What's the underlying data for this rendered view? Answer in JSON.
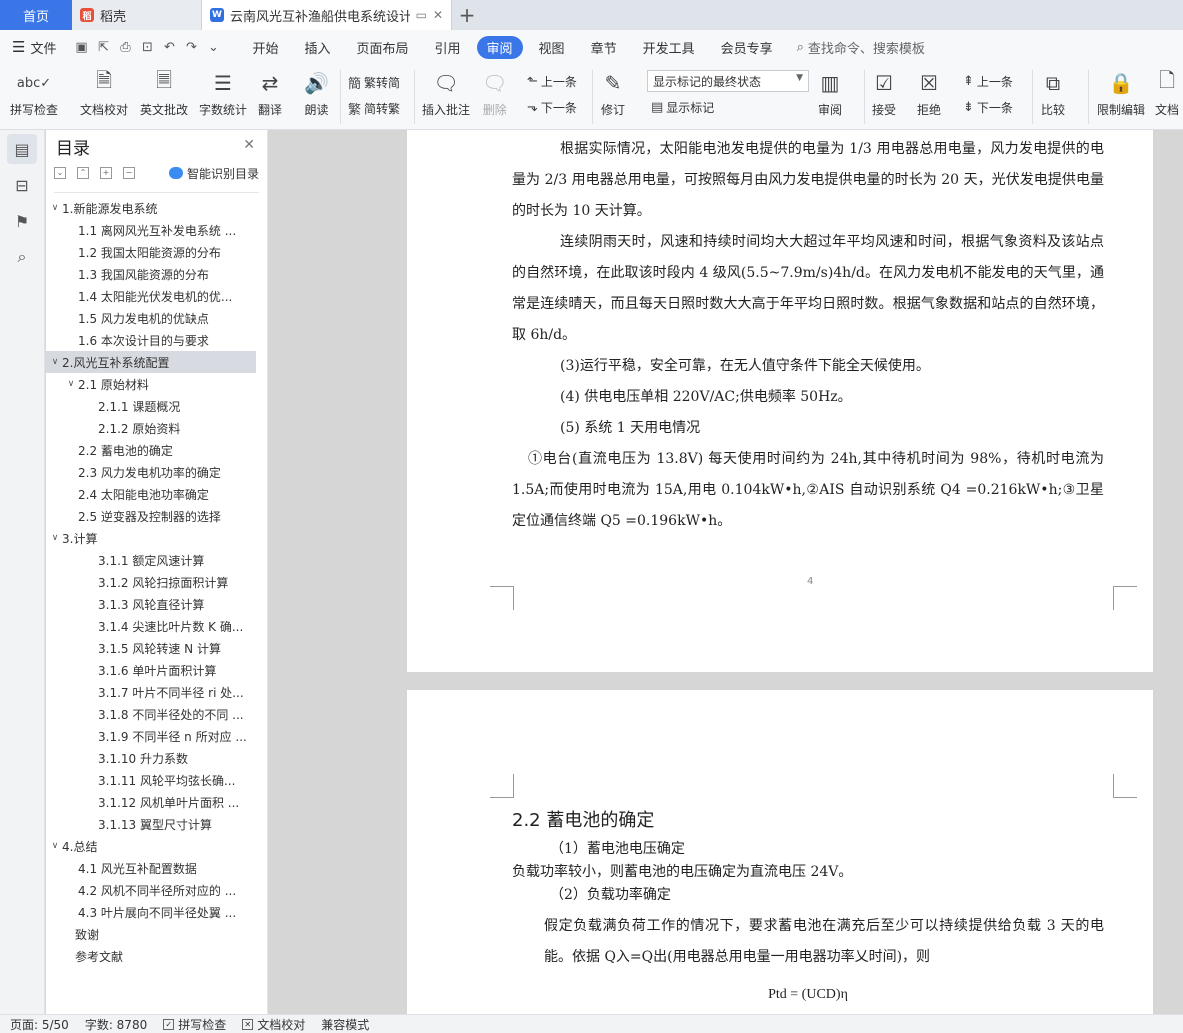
{
  "tabs": {
    "home": "首页",
    "daoke": "稻壳",
    "doc": "云南风光互补渔船供电系统设计"
  },
  "menu": {
    "file": "文件",
    "items": [
      "开始",
      "插入",
      "页面布局",
      "引用",
      "审阅",
      "视图",
      "章节",
      "开发工具",
      "会员专享"
    ],
    "active_index": 4,
    "search": "查找命令、搜索模板"
  },
  "ribbon": {
    "spellcheck": "拼写检查",
    "doc_proof": "文档校对",
    "en_review": "英文批改",
    "word_count": "字数统计",
    "translate": "翻译",
    "read_aloud": "朗读",
    "trad": "繁转简",
    "simp": "简转繁",
    "insert_comment": "插入批注",
    "delete": "删除",
    "prev1": "上一条",
    "next1": "下一条",
    "revise": "修订",
    "markup_state": "显示标记的最终状态",
    "show_markup": "显示标记",
    "review": "审阅",
    "accept": "接受",
    "reject": "拒绝",
    "prev2": "上一条",
    "next2": "下一条",
    "compare": "比较",
    "restrict": "限制编辑",
    "doc_perm": "文档"
  },
  "toc": {
    "title": "目录",
    "smart": "智能识别目录",
    "items": [
      {
        "label": "1.新能源发电系统",
        "level": 1,
        "caret": "∨"
      },
      {
        "label": "1.1 离网风光互补发电系统 ...",
        "level": 2,
        "caret": ""
      },
      {
        "label": "1.2 我国太阳能资源的分布",
        "level": 2,
        "caret": ""
      },
      {
        "label": "1.3 我国风能资源的分布",
        "level": 2,
        "caret": ""
      },
      {
        "label": "1.4 太阳能光伏发电机的优...",
        "level": 2,
        "caret": ""
      },
      {
        "label": "1.5 风力发电机的优缺点",
        "level": 2,
        "caret": ""
      },
      {
        "label": "1.6 本次设计目的与要求",
        "level": 2,
        "caret": ""
      },
      {
        "label": "2.风光互补系统配置",
        "level": 1,
        "caret": "∨",
        "selected": true
      },
      {
        "label": "2.1 原始材料",
        "level": 2,
        "caret": "∨"
      },
      {
        "label": "2.1.1 课题概况",
        "level": 3,
        "caret": ""
      },
      {
        "label": "2.1.2 原始资料",
        "level": 3,
        "caret": ""
      },
      {
        "label": "2.2  蓄电池的确定",
        "level": 2,
        "caret": ""
      },
      {
        "label": "2.3 风力发电机功率的确定",
        "level": 2,
        "caret": ""
      },
      {
        "label": "2.4 太阳能电池功率确定",
        "level": 2,
        "caret": ""
      },
      {
        "label": "2.5 逆变器及控制器的选择",
        "level": 2,
        "caret": ""
      },
      {
        "label": "3.计算",
        "level": 1,
        "caret": "∨"
      },
      {
        "label": "3.1.1 额定风速计算",
        "level": 3,
        "caret": ""
      },
      {
        "label": "3.1.2 风轮扫掠面积计算",
        "level": 3,
        "caret": ""
      },
      {
        "label": "3.1.3 风轮直径计算",
        "level": 3,
        "caret": ""
      },
      {
        "label": "3.1.4 尖速比叶片数 K 确...",
        "level": 3,
        "caret": ""
      },
      {
        "label": "3.1.5 风轮转速 N 计算",
        "level": 3,
        "caret": ""
      },
      {
        "label": "3.1.6 单叶片面积计算",
        "level": 3,
        "caret": ""
      },
      {
        "label": "3.1.7 叶片不同半径 ri 处...",
        "level": 3,
        "caret": ""
      },
      {
        "label": "3.1.8 不同半径处的不同 ...",
        "level": 3,
        "caret": ""
      },
      {
        "label": "3.1.9 不同半径 n 所对应 ...",
        "level": 3,
        "caret": ""
      },
      {
        "label": "3.1.10 升力系数",
        "level": 3,
        "caret": ""
      },
      {
        "label": "3.1.11 风轮平均弦长确...",
        "level": 3,
        "caret": ""
      },
      {
        "label": "3.1.12 风机单叶片面积 ...",
        "level": 3,
        "caret": ""
      },
      {
        "label": "3.1.13 翼型尺寸计算",
        "level": 3,
        "caret": ""
      },
      {
        "label": "4.总结",
        "level": 1,
        "caret": "∨"
      },
      {
        "label": "4.1 风光互补配置数据",
        "level": 2,
        "caret": ""
      },
      {
        "label": "4.2 风机不同半径所对应的 ...",
        "level": 2,
        "caret": ""
      },
      {
        "label": "4.3 叶片展向不同半径处翼 ...",
        "level": 2,
        "caret": ""
      },
      {
        "label": "致谢",
        "level": 1,
        "caret": ""
      },
      {
        "label": "参考文献",
        "level": 1,
        "caret": ""
      }
    ]
  },
  "page1": {
    "p1": "根据实际情况，太阳能电池发电提供的电量为 1/3 用电器总用电量，风力发电提供的电量为 2/3 用电器总用电量，可按照每月由风力发电提供电量的时长为 20 天，光伏发电提供电量的时长为 10 天计算。",
    "p2": "连续阴雨天时，风速和持续时间均大大超过年平均风速和时间，根据气象资料及该站点的自然环境，在此取该时段内 4 级风(5.5~7.9m/s)4h/d。在风力发电机不能发电的天气里，通常是连续晴天，而且每天日照时数大大高于年平均日照时数。根据气象数据和站点的自然环境，取 6h/d。",
    "p3": "(3)运行平稳，安全可靠，在无人值守条件下能全天候使用。",
    "p4": "(4)   供电电压单相 220V/AC;供电频率 50Hz。",
    "p5": "(5)   系统 1 天用电情况",
    "p6": "①电台(直流电压为 13.8V)  每天使用时间约为 24h,其中待机时间为 98%，待机时电流为 1.5A;而使用时电流为 15A,用电 0.104kW•h,②AIS 自动识别系统 Q4  =0.216kW•h;③卫星定位通信终端 Q5  =0.196kW•h。",
    "page_number": "4"
  },
  "page2": {
    "heading": "2.2 蓄电池的确定",
    "s1": "（1）蓄电池电压确定",
    "s1_text": "负载功率较小，则蓄电池的电压确定为直流电压 24V。",
    "s2": "（2）负载功率确定",
    "s2_text": "假定负载满负荷工作的情况下，要求蓄电池在满充后至少可以持续提供给负载 3 天的电能。依据 Q入=Q出(用电器总用电量一用电器功率乂时间)，则",
    "formula": "Ptd = (UCD)η"
  },
  "status": {
    "page": "页面: 5/50",
    "words": "字数: 8780",
    "spell": "拼写检查",
    "proof": "文档校对",
    "compat": "兼容模式"
  },
  "colors": {
    "accent": "#3b76e8",
    "selection": "#d7dae0"
  }
}
